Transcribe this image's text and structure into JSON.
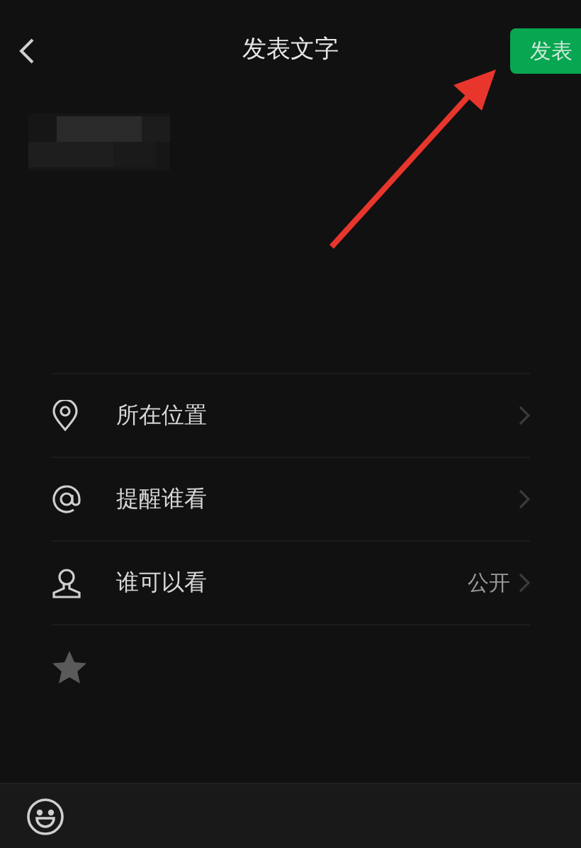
{
  "header": {
    "title": "发表文字",
    "publish_button": "发表"
  },
  "options": [
    {
      "kind": "location",
      "label": "所在位置"
    },
    {
      "kind": "mention",
      "label": "提醒谁看"
    },
    {
      "kind": "visibility",
      "label": "谁可以看",
      "value": "公开"
    }
  ]
}
